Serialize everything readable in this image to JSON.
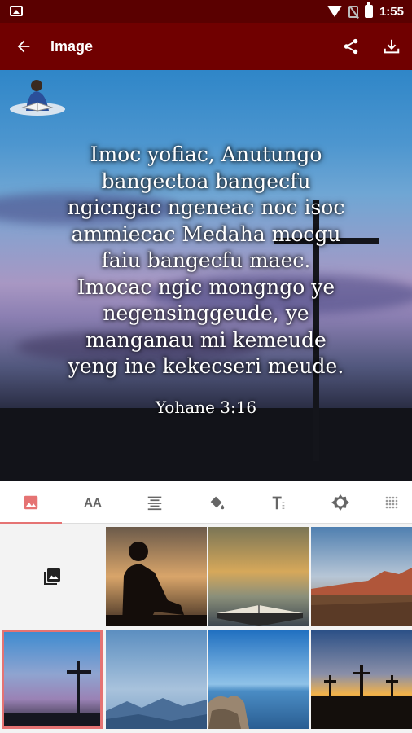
{
  "status_bar": {
    "time": "1:55"
  },
  "app_bar": {
    "title": "Image"
  },
  "preview": {
    "verse_lines": [
      "Imoc yofiac, Anutungo",
      "bangectoa bangecfu",
      "ngicngac ngeneac noc isoc",
      "ammiecac Medaha mocgu",
      "faiu bangecfu maec.",
      "Imocac ngic mongngo ye",
      "negensinggeude, ye",
      "manganau mi kemeude",
      "yeng ine kekecseri meude."
    ],
    "reference": "Yohane 3:16"
  },
  "tabs": [
    {
      "icon": "image-icon",
      "active": true
    },
    {
      "icon": "text-size-icon",
      "label": "AA"
    },
    {
      "icon": "align-icon"
    },
    {
      "icon": "paint-bucket-icon"
    },
    {
      "icon": "text-format-icon"
    },
    {
      "icon": "brightness-icon"
    },
    {
      "icon": "dots-grid-icon"
    }
  ],
  "backgrounds": [
    {
      "name": "gallery-picker",
      "icon": "photo-library-icon"
    },
    {
      "name": "boy-reading-sunset"
    },
    {
      "name": "bible-on-water"
    },
    {
      "name": "desert-mountains"
    },
    {
      "name": "cross-at-dusk",
      "selected": true
    },
    {
      "name": "misty-mountains"
    },
    {
      "name": "rocky-shore"
    },
    {
      "name": "three-crosses-sunset"
    }
  ],
  "colors": {
    "status_bar": "#5a0000",
    "app_bar": "#700000",
    "accent": "#e57373"
  }
}
